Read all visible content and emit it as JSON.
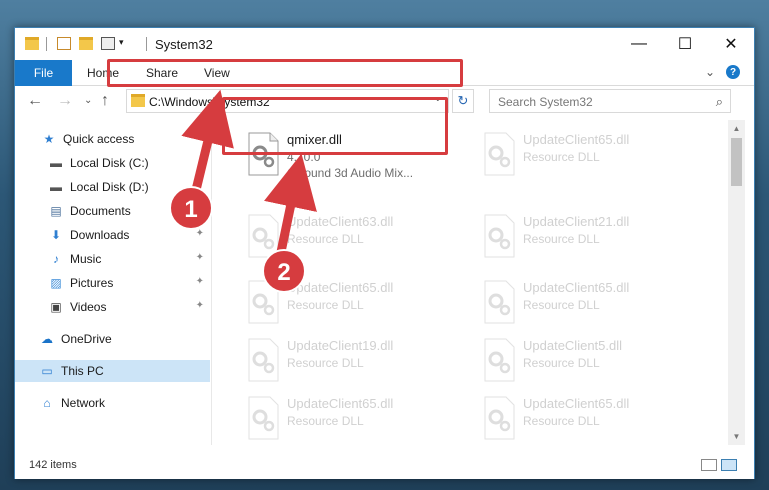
{
  "window": {
    "title": "System32"
  },
  "window_controls": {
    "minimize": "—",
    "maximize": "☐",
    "close": "✕"
  },
  "ribbon": {
    "tabs": [
      "File",
      "Home",
      "Share",
      "View"
    ],
    "collapse_glyph": "⌄",
    "help_glyph": "?"
  },
  "nav": {
    "back": "←",
    "forward": "→",
    "recent": "⌄",
    "up": "↑",
    "address": "C:\\Windows\\System32",
    "refresh": "↻",
    "search_placeholder": "Search System32",
    "search_glyph": "⌕"
  },
  "sidebar": {
    "items": [
      {
        "label": "Quick access",
        "icon": "star-icon",
        "glyph": "★",
        "color": "#2f7fd1"
      },
      {
        "label": "Local Disk (C:)",
        "icon": "drive-icon",
        "glyph": "▬",
        "color": "#555555"
      },
      {
        "label": "Local Disk (D:)",
        "icon": "drive-icon",
        "glyph": "▬",
        "color": "#555555"
      },
      {
        "label": "Documents",
        "icon": "document-icon",
        "glyph": "▤",
        "color": "#4a6f9a"
      },
      {
        "label": "Downloads",
        "icon": "download-icon",
        "glyph": "⬇",
        "color": "#2f7fd1"
      },
      {
        "label": "Music",
        "icon": "music-icon",
        "glyph": "♪",
        "color": "#2f7fd1"
      },
      {
        "label": "Pictures",
        "icon": "pictures-icon",
        "glyph": "▨",
        "color": "#3b8bd8"
      },
      {
        "label": "Videos",
        "icon": "video-icon",
        "glyph": "▣",
        "color": "#444444"
      },
      {
        "label": "OneDrive",
        "icon": "cloud-icon",
        "glyph": "☁",
        "color": "#1a73c8"
      },
      {
        "label": "This PC",
        "icon": "computer-icon",
        "glyph": "▭",
        "color": "#2f7fd1"
      },
      {
        "label": "Network",
        "icon": "network-icon",
        "glyph": "⌂",
        "color": "#2f7fd1"
      }
    ],
    "pin_glyph": "📌"
  },
  "files": [
    {
      "name": "qmixer.dll",
      "version": "4.10.0",
      "desc": "QSound 3d Audio Mix...",
      "faded": false
    },
    {
      "name": "UpdateClient65.dll",
      "version": "Resource DLL",
      "desc": "",
      "faded": true
    },
    {
      "name": "UpdateClient63.dll",
      "version": "Resource DLL",
      "desc": "",
      "faded": true
    },
    {
      "name": "UpdateClient21.dll",
      "version": "Resource DLL",
      "desc": "",
      "faded": true
    },
    {
      "name": "UpdateClient65.dll",
      "version": "Resource DLL",
      "desc": "",
      "faded": true
    },
    {
      "name": "UpdateClient65.dll",
      "version": "Resource DLL",
      "desc": "",
      "faded": true
    },
    {
      "name": "UpdateClient19.dll",
      "version": "Resource DLL",
      "desc": "",
      "faded": true
    },
    {
      "name": "UpdateClient5.dll",
      "version": "Resource DLL",
      "desc": "",
      "faded": true
    },
    {
      "name": "UpdateClient65.dll",
      "version": "Resource DLL",
      "desc": "",
      "faded": true
    },
    {
      "name": "UpdateClient65.dll",
      "version": "Resource DLL",
      "desc": "",
      "faded": true
    }
  ],
  "status": {
    "item_count": "142 items"
  },
  "annotations": [
    {
      "number": "1"
    },
    {
      "number": "2"
    }
  ],
  "colors": {
    "accent": "#1979ca",
    "highlight": "#d63c3f",
    "selected": "#cce4f7"
  }
}
